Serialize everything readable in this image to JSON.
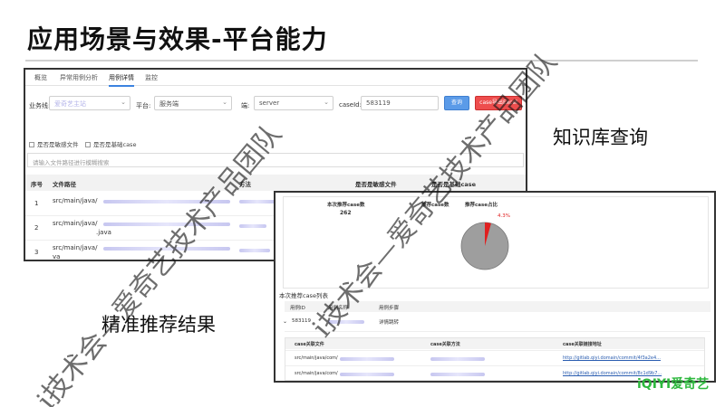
{
  "slide": {
    "title": "应用场景与效果-平台能力",
    "caption_knowledge": "知识库查询",
    "caption_recommend": "精准推荐结果",
    "brand": "iQIYI爱奇艺",
    "watermark": "i技术会—爱奇艺技术产品团队"
  },
  "colors": {
    "accent": "#3c83e0",
    "export_button": "#ee4d4d",
    "pie_main": "#9e9e9e",
    "pie_slice": "#e02020",
    "brand": "#2db83d"
  },
  "screen1": {
    "tabs": [
      "概览",
      "异常用例分析",
      "用例详情",
      "监控"
    ],
    "filters": {
      "business_label": "业务线:",
      "business_value": "爱奇艺主站",
      "platform_label": "平台:",
      "platform_value": "服务端",
      "end_label": "端:",
      "end_value": "server",
      "caseid_label": "caseId:",
      "caseid_value": "583119",
      "query_button": "查询",
      "export_button": "case导出Excel"
    },
    "checkboxes": [
      "是否是敏感文件",
      "是否是基础case"
    ],
    "search_placeholder": "请输入文件路径进行模糊搜索",
    "columns": [
      "序号",
      "文件路径",
      "方法",
      "是否是敏感文件",
      "是否是基础case"
    ],
    "rows": [
      {
        "index": "1",
        "path": "src/main/java/",
        "path2": ""
      },
      {
        "index": "2",
        "path": "src/main/java/",
        "path2": ".java"
      },
      {
        "index": "3",
        "path": "src/main/java/",
        "path2": "va"
      }
    ]
  },
  "screen2": {
    "stats": [
      {
        "label": "本次推荐case数",
        "value": "262"
      },
      {
        "label": "推荐case数"
      },
      {
        "label": "推荐case占比"
      }
    ],
    "pie": {
      "percent_label": "4.3%",
      "slice_fraction": 0.043
    },
    "section_title": "本次推荐case列表",
    "list_header": [
      "用例ID",
      "用例名称",
      "用例步骤"
    ],
    "list_row": {
      "id": "583119",
      "name": "",
      "steps": "详情跳转"
    },
    "sub_columns": [
      "case关联文件",
      "case关联方法",
      "case关联链接地址"
    ],
    "sub_rows": [
      {
        "file": "src/main/java/com/",
        "method": "",
        "link": "http://gitlab.qiyi.domain/commit/4f3a2e4..."
      },
      {
        "file": "src/main/java/com/",
        "method": "",
        "link": "http://gitlab.qiyi.domain/commit/8c1d9b7..."
      }
    ]
  }
}
